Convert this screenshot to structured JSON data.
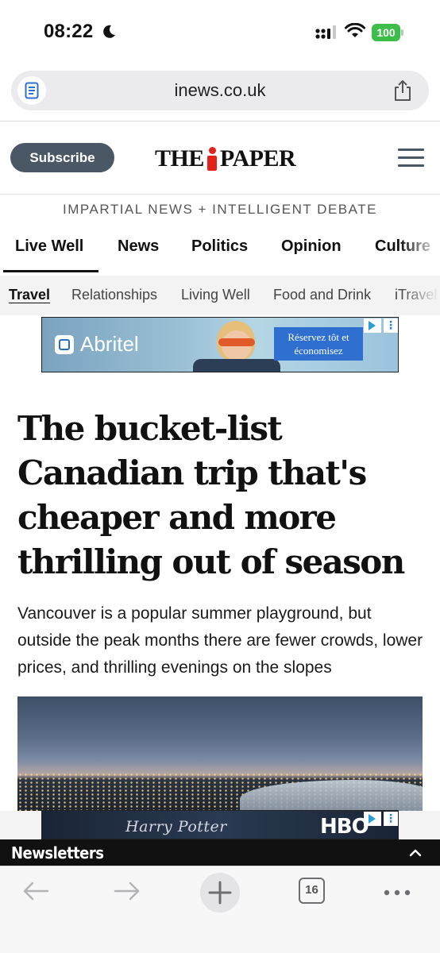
{
  "status_bar": {
    "time": "08:22",
    "battery": "100"
  },
  "browser": {
    "url": "inews.co.uk",
    "tab_count": "16"
  },
  "site": {
    "subscribe_label": "Subscribe",
    "logo_left": "THE",
    "logo_right": "PAPER",
    "tagline": "IMPARTIAL NEWS + INTELLIGENT DEBATE"
  },
  "main_nav": [
    {
      "label": "Live Well"
    },
    {
      "label": "News"
    },
    {
      "label": "Politics"
    },
    {
      "label": "Opinion"
    },
    {
      "label": "Culture"
    }
  ],
  "sub_nav": [
    {
      "label": "Travel"
    },
    {
      "label": "Relationships"
    },
    {
      "label": "Living Well"
    },
    {
      "label": "Food and Drink"
    },
    {
      "label": "iTravel"
    }
  ],
  "ad_top": {
    "brand": "Abritel",
    "cta_line1": "Réservez tôt et",
    "cta_line2": "économisez"
  },
  "article": {
    "headline": "The bucket-list Canadian trip that's cheaper and more thrilling out of season",
    "standfirst": "Vancouver is a popular summer playground, but outside the peak months there are fewer crowds, lower prices, and thrilling evenings on the slopes"
  },
  "ad_bottom": {
    "title": "Harry Potter",
    "network": "HBO"
  },
  "newsletters": {
    "label": "Newsletters"
  },
  "colors": {
    "subscribe_bg": "#4a5866",
    "logo_accent": "#e2231a",
    "battery": "#3dbd4a",
    "newsletters_bg": "#111111"
  }
}
